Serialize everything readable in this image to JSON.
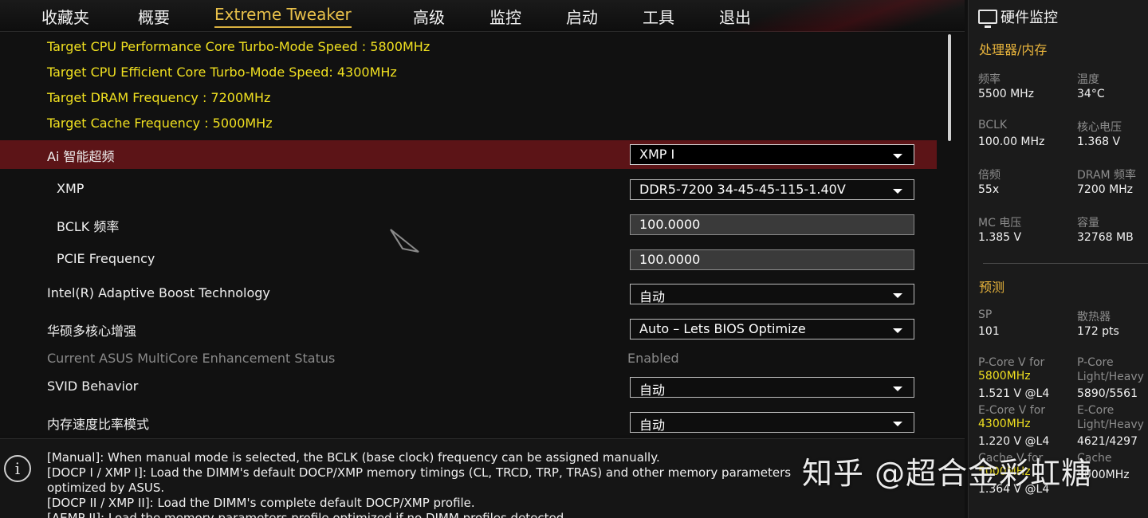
{
  "nav": {
    "tabs": [
      {
        "label": "收藏夹"
      },
      {
        "label": "概要"
      },
      {
        "label": "Extreme Tweaker"
      },
      {
        "label": "高级"
      },
      {
        "label": "监控"
      },
      {
        "label": "启动"
      },
      {
        "label": "工具"
      },
      {
        "label": "退出"
      }
    ],
    "active_tab": "Extreme Tweaker"
  },
  "targets": [
    "Target CPU Performance Core Turbo-Mode Speed : 5800MHz",
    "Target CPU Efficient Core Turbo-Mode Speed: 4300MHz",
    "Target DRAM Frequency : 7200MHz",
    "Target Cache Frequency : 5000MHz"
  ],
  "settings": [
    {
      "label": "Ai 智能超频",
      "value": "XMP I",
      "kind": "dropdown"
    },
    {
      "label": "XMP",
      "value": "DDR5-7200 34-45-45-115-1.40V",
      "kind": "dropdown"
    },
    {
      "label": "BCLK 频率",
      "value": "100.0000",
      "kind": "number"
    },
    {
      "label": "PCIE Frequency",
      "value": "100.0000",
      "kind": "number"
    },
    {
      "label": "Intel(R) Adaptive Boost Technology",
      "value": "自动",
      "kind": "dropdown"
    },
    {
      "label": "华硕多核心增强",
      "value": "Auto – Lets BIOS Optimize",
      "kind": "dropdown"
    },
    {
      "label": "Current ASUS MultiCore Enhancement Status",
      "value": "Enabled",
      "kind": "static"
    },
    {
      "label": "SVID Behavior",
      "value": "自动",
      "kind": "dropdown"
    },
    {
      "label": "内存速度比率模式",
      "value": "自动",
      "kind": "dropdown"
    }
  ],
  "help": {
    "lines": [
      "[Manual]: When manual mode is selected, the BCLK (base clock) frequency can be assigned manually.",
      "[DOCP I / XMP I]:  Load the DIMM's default DOCP/XMP memory timings (CL, TRCD, TRP, TRAS) and other memory parameters",
      "optimized by ASUS.",
      "[DOCP II / XMP II]:  Load the DIMM's complete default DOCP/XMP profile.",
      "[AEMP II]:  Load the memory parameters profile optimized if no DIMM profiles detected."
    ]
  },
  "hw_monitor": {
    "title": "硬件监控",
    "cpu_section": "处理器/内存",
    "metrics": [
      {
        "label": "频率",
        "value": "5500 MHz"
      },
      {
        "label": "温度",
        "value": "34°C"
      },
      {
        "label": "BCLK",
        "value": "100.00 MHz"
      },
      {
        "label": "核心电压",
        "value": "1.368 V"
      },
      {
        "label": "倍频",
        "value": "55x"
      },
      {
        "label": "DRAM 频率",
        "value": "7200 MHz"
      },
      {
        "label": "MC 电压",
        "value": "1.385 V"
      },
      {
        "label": "容量",
        "value": "32768 MB"
      }
    ],
    "predict_section": "预测",
    "sp": {
      "label": "SP",
      "value": "101"
    },
    "heatsink": {
      "label": "散热器",
      "value": "172 pts"
    },
    "pcore_v": {
      "label": "P-Core V for",
      "freq": "5800MHz",
      "value": "1.521 V @L4"
    },
    "pcore_lh": {
      "label1": "P-Core",
      "label2": "Light/Heavy",
      "value": "5890/5561"
    },
    "ecore_v": {
      "label": "E-Core V for",
      "freq": "4300MHz",
      "value": "1.220 V @L4"
    },
    "ecore_lh": {
      "label1": "E-Core",
      "label2": "Light/Heavy",
      "value": "4621/4297"
    },
    "cache_v": {
      "label": "Cache V for",
      "freq": "5000MHz",
      "value": "1.364 V @L4"
    },
    "cache_lh": {
      "label1": "Cache",
      "value": "5000MHz"
    }
  },
  "watermark": "知乎 @超合金彩虹糖",
  "colors": {
    "accent_yellow": "#f0e020",
    "highlight_red": "#5c1417",
    "section_orange": "#e8b43c"
  }
}
